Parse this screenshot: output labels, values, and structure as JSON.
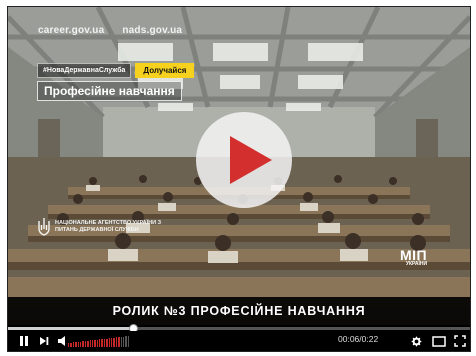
{
  "overlay": {
    "links": [
      "career.gov.ua",
      "nads.gov.ua"
    ],
    "hashtag": "#НоваДержавнаСлужба",
    "join_label": "Долучайся",
    "course_label": "Професійне навчання",
    "agency_name": "НАЦІОНАЛЬНЕ АГЕНТСТВО УКРАЇНИ З ПИТАНЬ ДЕРЖАВНОЇ СЛУЖБИ",
    "channel_logo": "МІП",
    "channel_logo_sub": "УКРАЇНИ"
  },
  "subtitle": "РОЛИК №3 ПРОФЕСІЙНЕ НАВЧАННЯ",
  "player": {
    "progress_fraction": 0.27,
    "current_time": "00:06",
    "duration": "0:22",
    "time_display": "00:06/0:22",
    "volume_fraction": 0.85,
    "icons": [
      "play-circle-icon",
      "pause-icon",
      "next-icon",
      "volume-icon",
      "gear-icon",
      "theater-mode-icon",
      "fullscreen-icon",
      "trident-icon"
    ]
  },
  "colors": {
    "play_button_red": "#d32f2f",
    "accent_yellow": "#f6d21e",
    "volume_red": "#c62828"
  }
}
